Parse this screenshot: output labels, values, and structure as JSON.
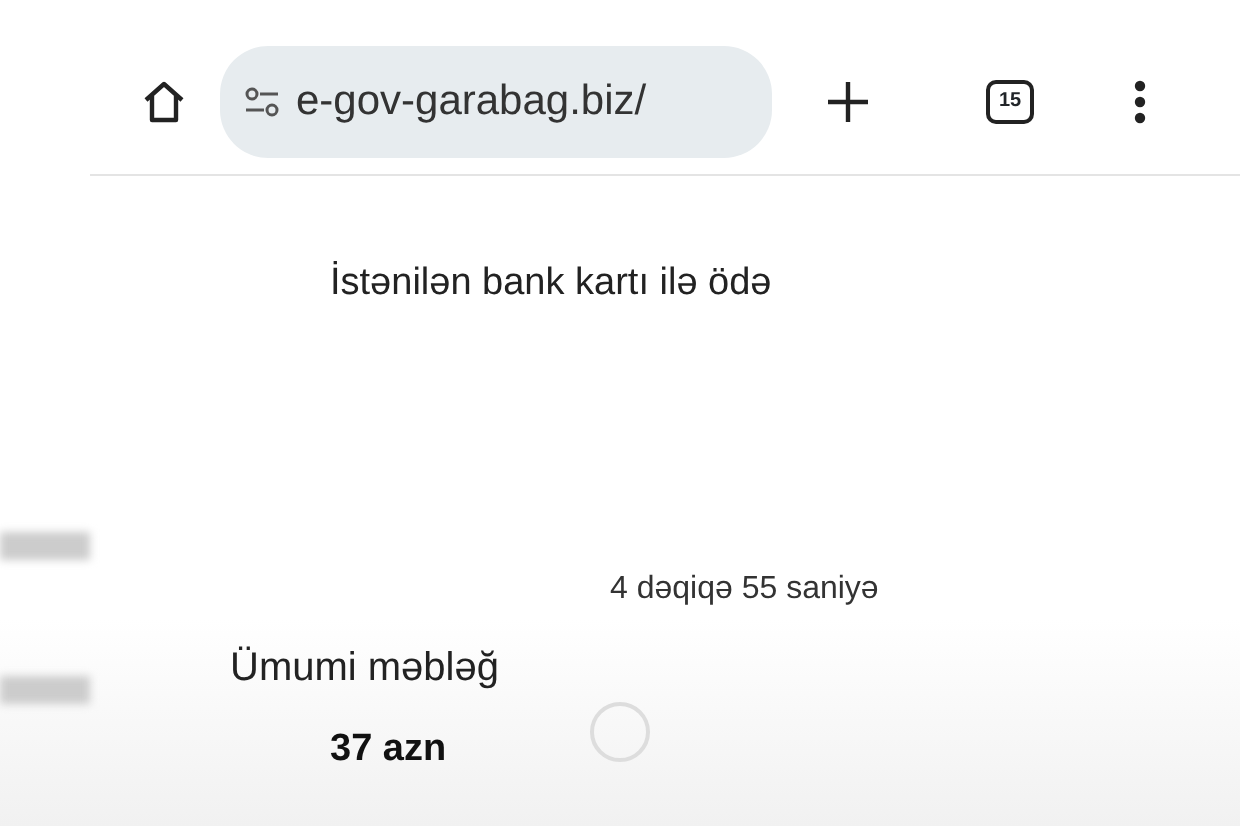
{
  "browser_bar": {
    "url": "e-gov-garabag.biz/",
    "tab_count": "15"
  },
  "page": {
    "heading": "İstənilən bank kartı ilə ödə",
    "timer": "4 dəqiqə 55 saniyə",
    "total_label": "Ümumi məbləğ",
    "total_amount": "37 azn"
  }
}
